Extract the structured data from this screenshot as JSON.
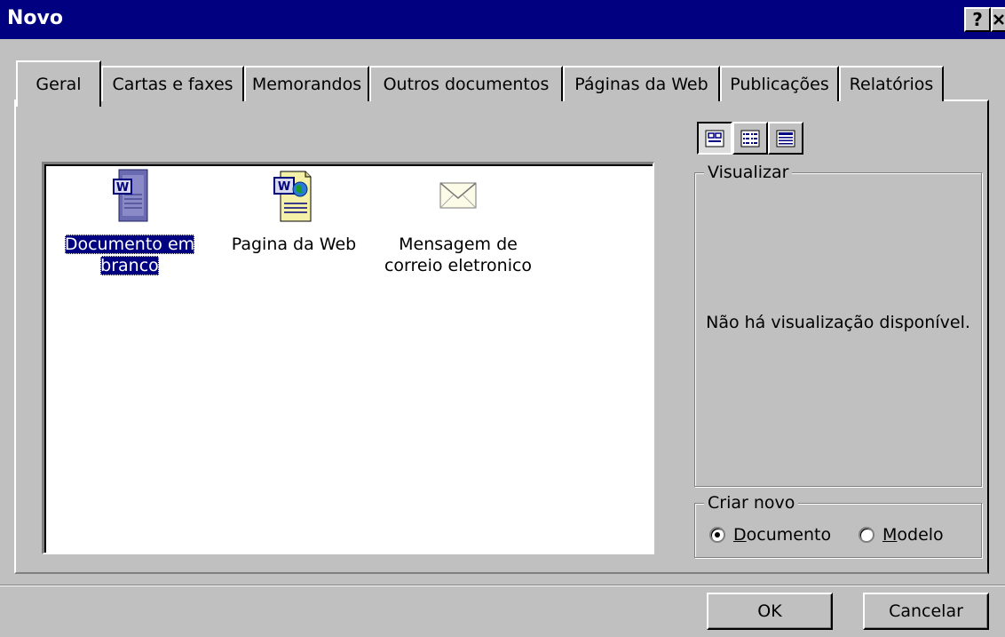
{
  "dialog": {
    "title": "Novo",
    "help_label": "?",
    "close_label": "✕"
  },
  "tabs": [
    {
      "label": "Geral"
    },
    {
      "label": "Cartas e faxes"
    },
    {
      "label": "Memorandos"
    },
    {
      "label": "Outros documentos"
    },
    {
      "label": "Páginas da Web"
    },
    {
      "label": "Publicações"
    },
    {
      "label": "Relatórios"
    }
  ],
  "templates": [
    {
      "label_line1": "Documento em",
      "label_line2": "branco",
      "icon": "word-document-icon",
      "selected": true
    },
    {
      "label_line1": "Pagina da Web",
      "label_line2": "",
      "icon": "word-web-page-icon",
      "selected": false
    },
    {
      "label_line1": "Mensagem de",
      "label_line2": "correio eletronico",
      "icon": "envelope-icon",
      "selected": false
    }
  ],
  "view_buttons": [
    {
      "icon": "large-icons-view-icon",
      "pressed": true
    },
    {
      "icon": "list-view-icon",
      "pressed": false
    },
    {
      "icon": "details-view-icon",
      "pressed": false
    }
  ],
  "preview": {
    "legend": "Visualizar",
    "message": "Não há visualização disponível."
  },
  "create_new": {
    "legend": "Criar novo",
    "options": [
      {
        "label_first": "D",
        "label_rest": "ocumento",
        "checked": true
      },
      {
        "label_first": "M",
        "label_rest": "odelo",
        "checked": false
      }
    ]
  },
  "buttons": {
    "ok": "OK",
    "cancel": "Cancelar"
  },
  "colors": {
    "titlebar": "#000080",
    "face": "#c0c0c0",
    "selection": "#000080"
  }
}
